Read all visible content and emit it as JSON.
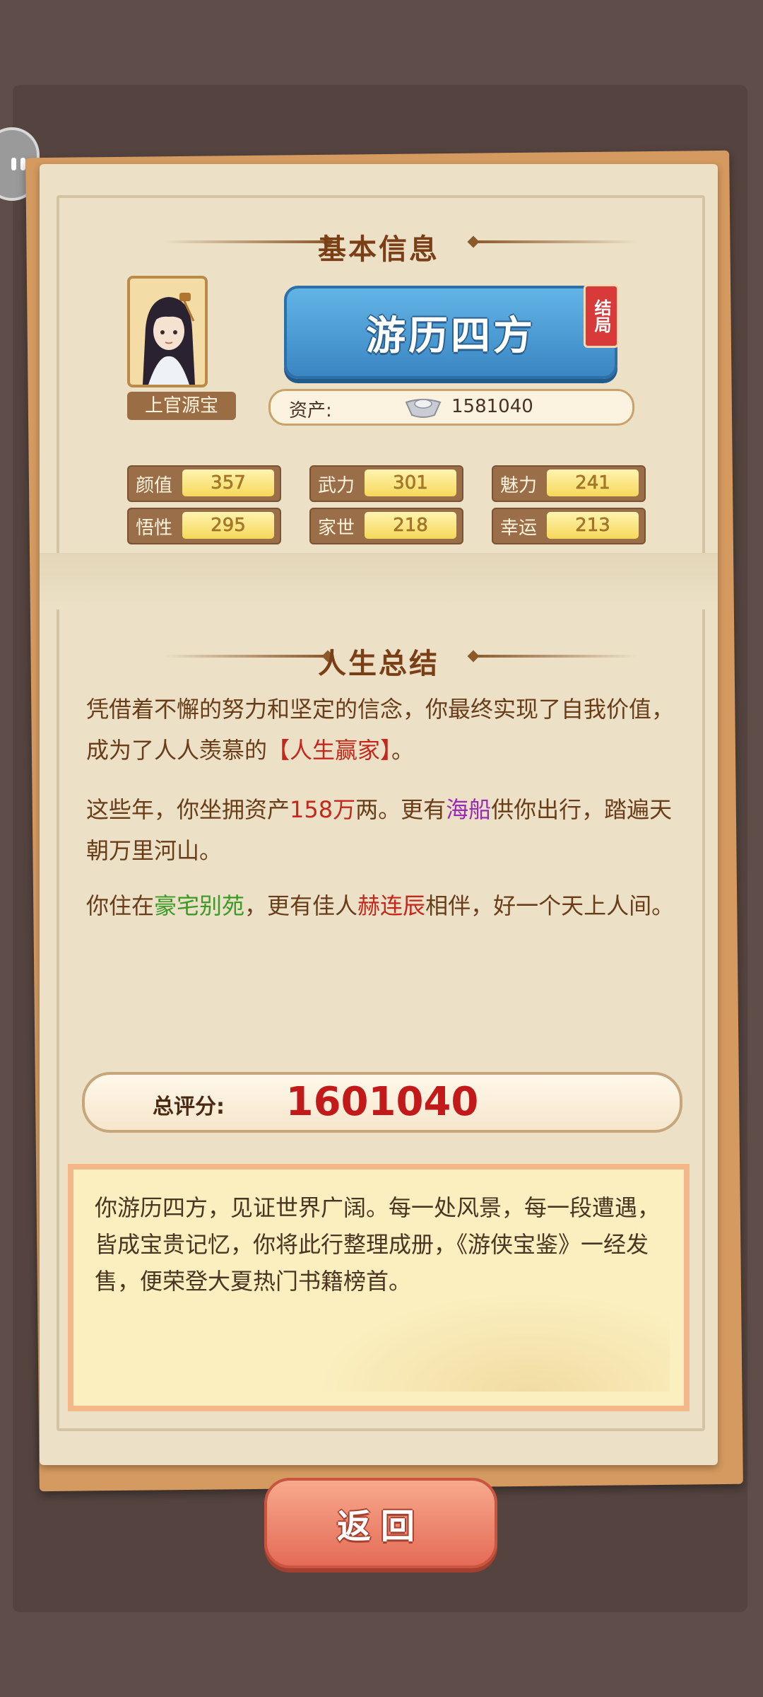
{
  "basic_info": {
    "title": "基本信息"
  },
  "character": {
    "name": "上官源宝"
  },
  "ending": {
    "name": "游历四方",
    "badge": "结局"
  },
  "assets": {
    "label": "资产:",
    "icon": "silver-ingot-icon",
    "value": "1581040"
  },
  "stats": [
    {
      "label": "颜值",
      "value": "357"
    },
    {
      "label": "武力",
      "value": "301"
    },
    {
      "label": "魅力",
      "value": "241"
    },
    {
      "label": "悟性",
      "value": "295"
    },
    {
      "label": "家世",
      "value": "218"
    },
    {
      "label": "幸运",
      "value": "213"
    }
  ],
  "life_summary": {
    "title": "人生总结",
    "p1_a": "凭借着不懈的努力和坚定的信念，你最终实现了自我价值，成为了人人羡慕的",
    "p1_hl": "【人生赢家】",
    "p1_b": "。",
    "p2_a": "这些年，你坐拥资产",
    "p2_hl1": "158万",
    "p2_b": "两。更有",
    "p2_hl2": "海船",
    "p2_c": "供你出行，踏遍天朝万里河山。",
    "p3_a": "你住在",
    "p3_hl1": "豪宅别苑",
    "p3_b": "，更有佳人",
    "p3_hl2": "赫连辰",
    "p3_c": "相伴，好一个天上人间。"
  },
  "score": {
    "label": "总评分:",
    "value": "1601040"
  },
  "epilogue": {
    "text": "你游历四方，见证世界广阔。每一处风景，每一段遭遇，皆成宝贵记忆，你将此行整理成册，《游侠宝鉴》一经发售，便荣登大夏热门书籍榜首。"
  },
  "back_button": {
    "label": "返回"
  },
  "colors": {
    "highlight_red": "#c4271b",
    "highlight_purple": "#9a2ab5",
    "highlight_green": "#3a9a25",
    "ending_blue": "#3a86c3"
  }
}
